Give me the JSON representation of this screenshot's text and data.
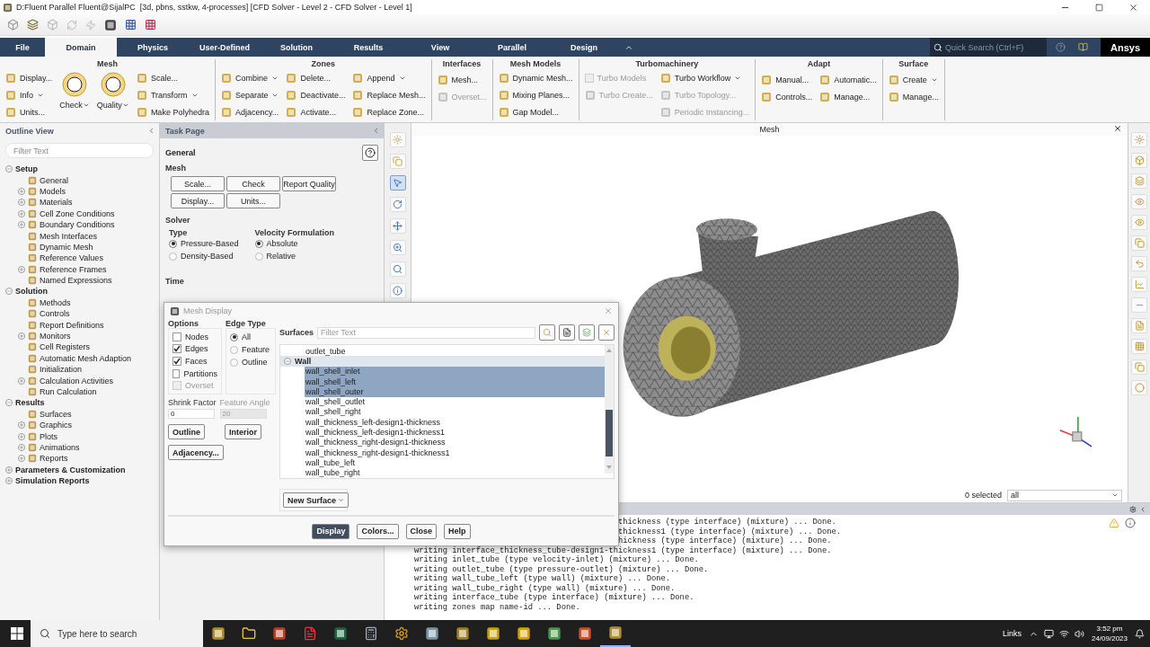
{
  "window": {
    "title": "D:Fluent Parallel Fluent@SijalPC  [3d, pbns, sstkw, 4-processes] [CFD Solver - Level 2 - CFD Solver - Level 1]"
  },
  "tabs": [
    {
      "label": "File",
      "selected": false
    },
    {
      "label": "Domain",
      "selected": true
    },
    {
      "label": "Physics",
      "selected": false
    },
    {
      "label": "User-Defined",
      "selected": false
    },
    {
      "label": "Solution",
      "selected": false
    },
    {
      "label": "Results",
      "selected": false
    },
    {
      "label": "View",
      "selected": false
    },
    {
      "label": "Parallel",
      "selected": false
    },
    {
      "label": "Design",
      "selected": false
    }
  ],
  "quick_search": {
    "placeholder": "Quick Search (Ctrl+F)"
  },
  "brand": "Ansys",
  "ribbon": [
    {
      "title": "Mesh",
      "columns": [
        [
          {
            "label": "Display...",
            "kind": "small",
            "disabled": false,
            "menu": false
          },
          {
            "label": "Info",
            "kind": "small",
            "disabled": false,
            "menu": true
          },
          {
            "label": "Units...",
            "kind": "small",
            "disabled": false,
            "menu": false
          }
        ],
        [
          {
            "label": "Check",
            "kind": "big",
            "disabled": false,
            "menu": true
          }
        ],
        [
          {
            "label": "Quality",
            "kind": "big",
            "disabled": false,
            "menu": true
          }
        ],
        [
          {
            "label": "Scale...",
            "kind": "small",
            "disabled": false,
            "menu": false
          },
          {
            "label": "Transform",
            "kind": "small",
            "disabled": false,
            "menu": true
          },
          {
            "label": "Make Polyhedra",
            "kind": "small",
            "disabled": false,
            "menu": false
          }
        ]
      ]
    },
    {
      "title": "Zones",
      "columns": [
        [
          {
            "label": "Combine",
            "kind": "small",
            "disabled": false,
            "menu": true
          },
          {
            "label": "Separate",
            "kind": "small",
            "disabled": false,
            "menu": true
          },
          {
            "label": "Adjacency...",
            "kind": "small",
            "disabled": false,
            "menu": false
          }
        ],
        [
          {
            "label": "Delete...",
            "kind": "small",
            "disabled": false,
            "menu": false
          },
          {
            "label": "Deactivate...",
            "kind": "small",
            "disabled": false,
            "menu": false
          },
          {
            "label": "Activate...",
            "kind": "small",
            "disabled": false,
            "menu": false
          }
        ],
        [
          {
            "label": "Append",
            "kind": "small",
            "disabled": false,
            "menu": true
          },
          {
            "label": "Replace Mesh...",
            "kind": "small",
            "disabled": false,
            "menu": false
          },
          {
            "label": "Replace Zone...",
            "kind": "small",
            "disabled": false,
            "menu": false
          }
        ]
      ]
    },
    {
      "title": "Interfaces",
      "columns": [
        [
          {
            "label": "Mesh...",
            "kind": "small",
            "disabled": false,
            "menu": false
          },
          {
            "label": "Overset...",
            "kind": "small",
            "disabled": true,
            "menu": false
          }
        ]
      ]
    },
    {
      "title": "Mesh Models",
      "columns": [
        [
          {
            "label": "Dynamic Mesh...",
            "kind": "small",
            "disabled": false,
            "menu": false
          },
          {
            "label": "Mixing Planes...",
            "kind": "small",
            "disabled": false,
            "menu": false
          },
          {
            "label": "Gap Model...",
            "kind": "small",
            "disabled": false,
            "menu": false
          }
        ]
      ]
    },
    {
      "title": "Turbomachinery",
      "columns": [
        [
          {
            "label": "Turbo Models",
            "kind": "check",
            "checked": false,
            "disabled": true,
            "menu": false
          },
          {
            "label": "Turbo Create...",
            "kind": "small",
            "disabled": true,
            "menu": false
          }
        ],
        [
          {
            "label": "Turbo Workflow",
            "kind": "small",
            "disabled": false,
            "menu": true
          },
          {
            "label": "Turbo Topology...",
            "kind": "small",
            "disabled": true,
            "menu": false
          },
          {
            "label": "Periodic Instancing...",
            "kind": "small",
            "disabled": true,
            "menu": false
          }
        ]
      ]
    },
    {
      "title": "Adapt",
      "columns": [
        [
          {
            "label": "Manual...",
            "kind": "small",
            "disabled": false,
            "menu": false
          },
          {
            "label": "Controls...",
            "kind": "small",
            "disabled": false,
            "menu": false
          }
        ],
        [
          {
            "label": "Automatic...",
            "kind": "small",
            "disabled": false,
            "menu": false
          },
          {
            "label": "Manage...",
            "kind": "small",
            "disabled": false,
            "menu": false
          }
        ]
      ]
    },
    {
      "title": "Surface",
      "columns": [
        [
          {
            "label": "Create",
            "kind": "small",
            "disabled": false,
            "menu": true
          },
          {
            "label": "Manage...",
            "kind": "small",
            "disabled": false,
            "menu": false
          }
        ]
      ]
    }
  ],
  "outline": {
    "title": "Outline View",
    "filter_placeholder": "Filter Text",
    "tree": [
      {
        "label": "Setup",
        "expanded": true,
        "children": [
          {
            "label": "General"
          },
          {
            "label": "Models",
            "expanded": false
          },
          {
            "label": "Materials",
            "expanded": false
          },
          {
            "label": "Cell Zone Conditions",
            "expanded": false
          },
          {
            "label": "Boundary Conditions",
            "expanded": false
          },
          {
            "label": "Mesh Interfaces"
          },
          {
            "label": "Dynamic Mesh"
          },
          {
            "label": "Reference Values"
          },
          {
            "label": "Reference Frames",
            "expanded": false
          },
          {
            "label": "Named Expressions"
          }
        ]
      },
      {
        "label": "Solution",
        "expanded": true,
        "children": [
          {
            "label": "Methods"
          },
          {
            "label": "Controls"
          },
          {
            "label": "Report Definitions"
          },
          {
            "label": "Monitors",
            "expanded": false
          },
          {
            "label": "Cell Registers"
          },
          {
            "label": "Automatic Mesh Adaption"
          },
          {
            "label": "Initialization"
          },
          {
            "label": "Calculation Activities",
            "expanded": false
          },
          {
            "label": "Run Calculation"
          }
        ]
      },
      {
        "label": "Results",
        "expanded": true,
        "children": [
          {
            "label": "Surfaces"
          },
          {
            "label": "Graphics",
            "expanded": false
          },
          {
            "label": "Plots",
            "expanded": false
          },
          {
            "label": "Animations",
            "expanded": false
          },
          {
            "label": "Reports",
            "expanded": false
          }
        ]
      },
      {
        "label": "Parameters & Customization",
        "expanded": false
      },
      {
        "label": "Simulation Reports",
        "expanded": false
      }
    ]
  },
  "task_page": {
    "title": "Task Page",
    "heading": "General",
    "mesh_label": "Mesh",
    "mesh_buttons": [
      "Scale...",
      "Check",
      "Report Quality",
      "Display...",
      "Units..."
    ],
    "solver_label": "Solver",
    "type": {
      "label": "Type",
      "options": [
        {
          "label": "Pressure-Based",
          "selected": true
        },
        {
          "label": "Density-Based",
          "selected": false
        }
      ]
    },
    "velocity": {
      "label": "Velocity Formulation",
      "options": [
        {
          "label": "Absolute",
          "selected": true
        },
        {
          "label": "Relative",
          "selected": false
        }
      ]
    },
    "time_label": "Time"
  },
  "graphics": {
    "title": "Mesh",
    "selection_count": "0 selected",
    "selection_filter": "all"
  },
  "mesh_display": {
    "title": "Mesh Display",
    "options_label": "Options",
    "options": [
      {
        "label": "Nodes",
        "checked": false,
        "disabled": false
      },
      {
        "label": "Edges",
        "checked": true,
        "disabled": false
      },
      {
        "label": "Faces",
        "checked": true,
        "disabled": false
      },
      {
        "label": "Partitions",
        "checked": false,
        "disabled": false
      },
      {
        "label": "Overset",
        "checked": false,
        "disabled": true
      }
    ],
    "edge_type_label": "Edge Type",
    "edge_types": [
      {
        "label": "All",
        "selected": true
      },
      {
        "label": "Feature",
        "selected": false
      },
      {
        "label": "Outline",
        "selected": false
      }
    ],
    "shrink_factor": {
      "label": "Shrink Factor",
      "value": "0"
    },
    "feature_angle": {
      "label": "Feature Angle",
      "value": "20",
      "disabled": true
    },
    "left_buttons": [
      "Outline",
      "Interior",
      "Adjacency..."
    ],
    "surfaces_label": "Surfaces",
    "filter_placeholder": "Filter Text",
    "surfaces": [
      {
        "label": "outlet_tube",
        "selected": false
      },
      {
        "label": "Wall",
        "expanded": true,
        "children": [
          {
            "label": "wall_shell_inlet",
            "selected": true
          },
          {
            "label": "wall_shell_left",
            "selected": true
          },
          {
            "label": "wall_shell_outer",
            "selected": true
          },
          {
            "label": "wall_shell_outlet",
            "selected": false
          },
          {
            "label": "wall_shell_right",
            "selected": false
          },
          {
            "label": "wall_thickness_left-design1-thickness",
            "selected": false
          },
          {
            "label": "wall_thickness_left-design1-thickness1",
            "selected": false
          },
          {
            "label": "wall_thickness_right-design1-thickness",
            "selected": false
          },
          {
            "label": "wall_thickness_right-design1-thickness1",
            "selected": false
          },
          {
            "label": "wall_tube_left",
            "selected": false
          },
          {
            "label": "wall_tube_right",
            "selected": false
          }
        ]
      }
    ],
    "new_surface": "New Surface",
    "footer_buttons": [
      {
        "label": "Display",
        "primary": true
      },
      {
        "label": "Colors...",
        "primary": false
      },
      {
        "label": "Close",
        "primary": false
      },
      {
        "label": "Help",
        "primary": false
      }
    ]
  },
  "console": [
    {
      "text": "thickness (type interface) (mixture) ... Done.",
      "clipped": true
    },
    {
      "text": "thickness1 (type interface) (mixture) ... Done.",
      "clipped": true
    },
    {
      "text": "hickness (type interface) (mixture) ... Done.",
      "clipped": true
    },
    {
      "text": "writing interface_thickness_tube-design1-thickness1 (type interface) (mixture) ... Done."
    },
    {
      "text": "writing inlet_tube (type velocity-inlet) (mixture) ... Done."
    },
    {
      "text": "writing outlet_tube (type pressure-outlet) (mixture) ... Done."
    },
    {
      "text": "writing wall_tube_left (type wall) (mixture) ... Done."
    },
    {
      "text": "writing wall_tube_right (type wall) (mixture) ... Done."
    },
    {
      "text": "writing interface_tube (type interface) (mixture) ... Done."
    },
    {
      "text": "writing zones map name-id ... Done."
    }
  ],
  "taskbar": {
    "search_placeholder": "Type here to search",
    "links": "Links",
    "time": "3:52 pm",
    "date": "24/09/2023"
  }
}
